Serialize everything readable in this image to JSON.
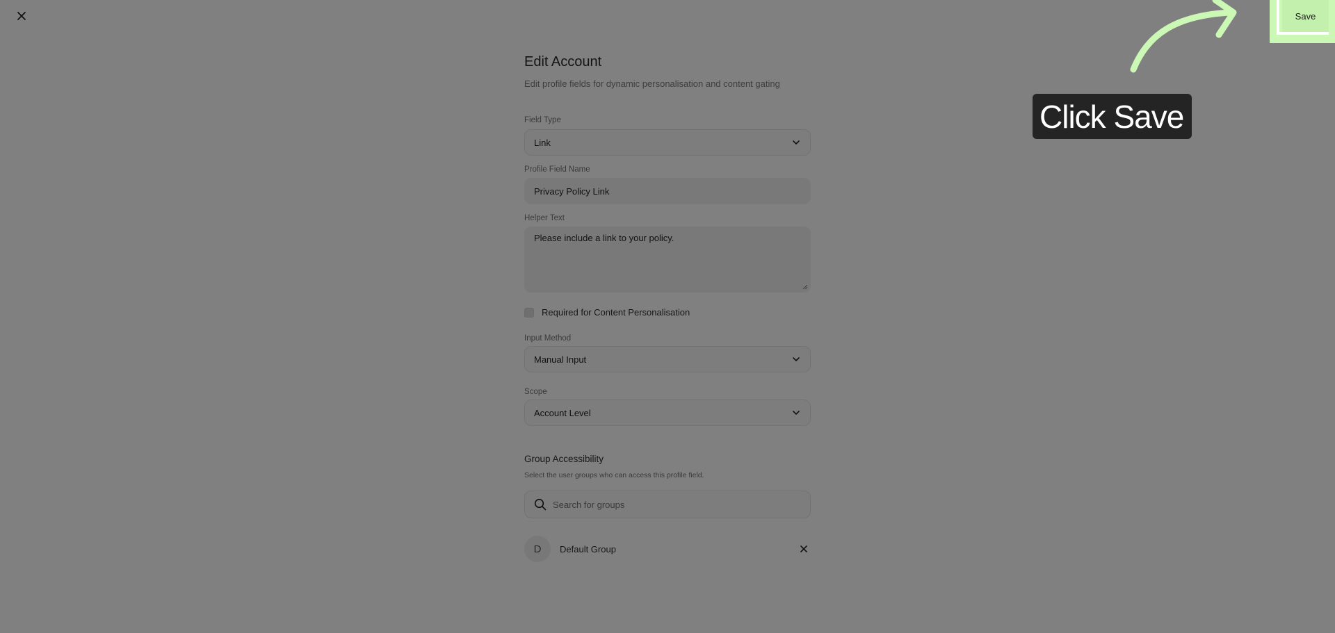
{
  "header": {
    "close_icon": "close-icon"
  },
  "form": {
    "title": "Edit Account",
    "subtitle": "Edit profile fields for dynamic personalisation and content gating",
    "field_type": {
      "label": "Field Type",
      "value": "Link"
    },
    "profile_field_name": {
      "label": "Profile Field Name",
      "value": "Privacy Policy Link"
    },
    "helper_text": {
      "label": "Helper Text",
      "value": "Please include a link to your policy."
    },
    "required_checkbox": {
      "label": "Required for Content Personalisation",
      "checked": false
    },
    "input_method": {
      "label": "Input Method",
      "value": "Manual Input"
    },
    "scope": {
      "label": "Scope",
      "value": "Account Level"
    },
    "group_accessibility": {
      "title": "Group Accessibility",
      "description": "Select the user groups who can access this profile field.",
      "search_placeholder": "Search for groups",
      "groups": [
        {
          "initial": "D",
          "name": "Default Group"
        }
      ]
    }
  },
  "toolbar": {
    "save_label": "Save"
  },
  "annotation": {
    "text": "Click Save"
  },
  "colors": {
    "highlight": "#ccf8b6",
    "tooltip_bg": "#242424",
    "overlay": "#808080"
  }
}
